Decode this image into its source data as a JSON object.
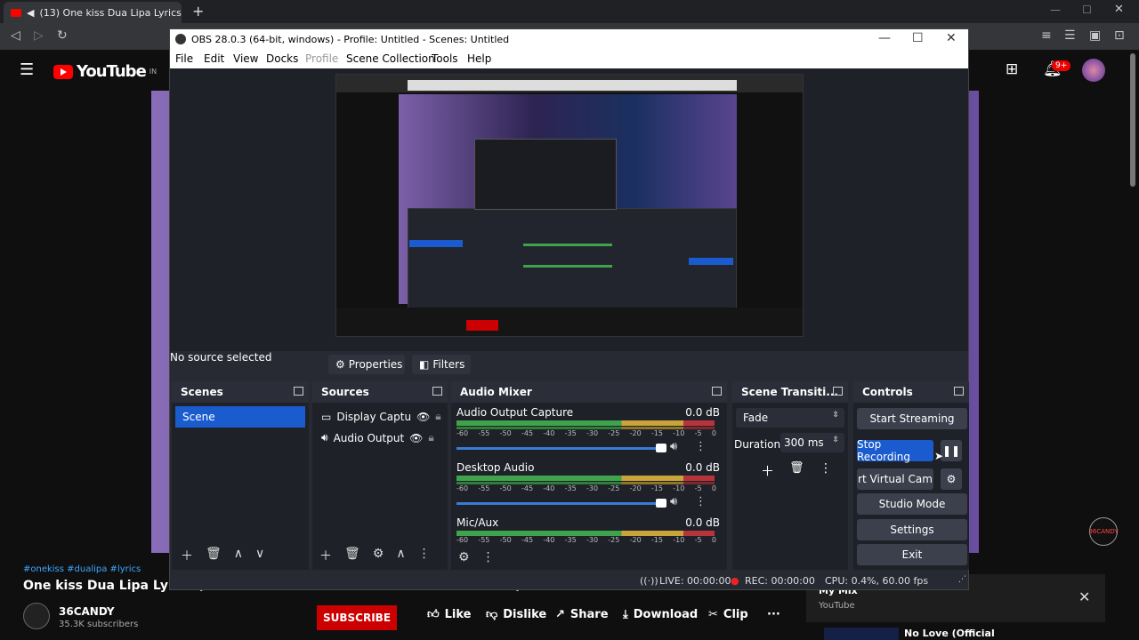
{
  "browser": {
    "tab_title": "(13) One kiss Dua Lipa Lyrics (C",
    "new_tab": "+"
  },
  "youtube": {
    "logo_text": "YouTube",
    "country": "IN",
    "notifications": "9+",
    "hashtags": "#onekiss #dualipa #lyrics",
    "video_title": "One kiss Dua Lipa Lyrics (One kiss is all it takes Fallin' in love with me)",
    "channel_name": "36CANDY",
    "subscribers": "35.3K subscribers",
    "subscribe": "SUBSCRIBE",
    "like": "Like",
    "dislike": "Dislike",
    "share": "Share",
    "download": "Download",
    "clip": "Clip",
    "more": "···",
    "mix_title": "My Mix",
    "mix_sub": "YouTube",
    "next_title": "No Love (Official",
    "watermark": "36CANDY"
  },
  "obs": {
    "title": "OBS 28.0.3 (64-bit, windows) - Profile: Untitled - Scenes: Untitled",
    "menu": [
      "File",
      "Edit",
      "View",
      "Docks",
      "Profile",
      "Scene Collection",
      "Tools",
      "Help"
    ],
    "no_source": "No source selected",
    "properties": "Properties",
    "filters": "Filters",
    "docks": {
      "scenes": "Scenes",
      "sources": "Sources",
      "audio_mixer": "Audio Mixer",
      "transitions": "Scene Transiti...",
      "controls": "Controls"
    },
    "scene_items": [
      "Scene"
    ],
    "sources": [
      "Display Captu",
      "Audio Output"
    ],
    "mixer": [
      {
        "name": "Audio Output Capture",
        "db": "0.0 dB"
      },
      {
        "name": "Desktop Audio",
        "db": "0.0 dB"
      },
      {
        "name": "Mic/Aux",
        "db": "0.0 dB"
      }
    ],
    "ticks": [
      "-60",
      "-55",
      "-50",
      "-45",
      "-40",
      "-35",
      "-30",
      "-25",
      "-20",
      "-15",
      "-10",
      "-5",
      "0"
    ],
    "transition": {
      "type": "Fade",
      "duration_label": "Duration",
      "duration_value": "300 ms"
    },
    "controls": {
      "start_streaming": "Start Streaming",
      "stop_recording": "Stop Recording",
      "virtual_cam": "rt Virtual Cam",
      "studio_mode": "Studio Mode",
      "settings": "Settings",
      "exit": "Exit"
    },
    "status": {
      "live": "LIVE: 00:00:00",
      "rec": "REC: 00:00:00",
      "cpu": "CPU: 0.4%, 60.00 fps"
    }
  },
  "colors": {
    "youtube_red": "#ff0000",
    "obs_accent": "#1a5cce",
    "obs_dark": "#1f2129"
  }
}
